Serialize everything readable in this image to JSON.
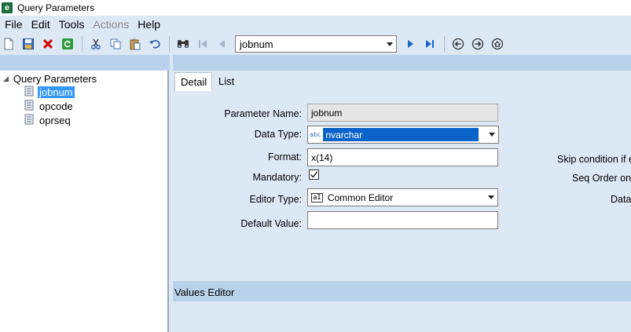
{
  "window": {
    "title": "Query Parameters",
    "logo_letter": "e"
  },
  "menu": [
    {
      "label": "File",
      "enabled": true
    },
    {
      "label": "Edit",
      "enabled": true
    },
    {
      "label": "Tools",
      "enabled": true
    },
    {
      "label": "Actions",
      "enabled": false
    },
    {
      "label": "Help",
      "enabled": true
    }
  ],
  "toolbar": {
    "record_combo_value": "jobnum",
    "icons": [
      "new-icon",
      "save-icon",
      "delete-icon",
      "refresh-icon",
      "cut-icon",
      "copy-icon",
      "paste-icon",
      "undo-icon",
      "binoculars-icon",
      "first-icon",
      "prev-icon",
      "next-icon",
      "last-icon",
      "back-icon",
      "forward-icon",
      "home-icon"
    ]
  },
  "tree": {
    "root_label": "Query Parameters",
    "items": [
      {
        "label": "jobnum",
        "selected": true
      },
      {
        "label": "opcode",
        "selected": false
      },
      {
        "label": "oprseq",
        "selected": false
      }
    ]
  },
  "tabs": [
    {
      "label": "Detail",
      "active": true
    },
    {
      "label": "List",
      "active": false
    }
  ],
  "detail": {
    "parameter_name_label": "Parameter Name:",
    "parameter_name_value": "jobnum",
    "data_type_label": "Data Type:",
    "data_type_tag": "abc",
    "data_type_value": "nvarchar",
    "format_label": "Format:",
    "format_value": "x(14)",
    "mandatory_label": "Mandatory:",
    "mandatory_checked": true,
    "editor_type_label": "Editor Type:",
    "editor_type_tag": "aI",
    "editor_type_value": "Common Editor",
    "default_value_label": "Default Value:",
    "default_value_value": "",
    "right_labels": {
      "skip_condition": "Skip condition if e",
      "seq_order": "Seq Order on",
      "data": "Data"
    }
  },
  "values_editor": {
    "title": "Values Editor"
  },
  "colors": {
    "selection": "#3399ff",
    "panel_bg": "#dde8f5",
    "strip_bg": "#b9d1ea",
    "combo_highlight": "#0a63c9"
  }
}
